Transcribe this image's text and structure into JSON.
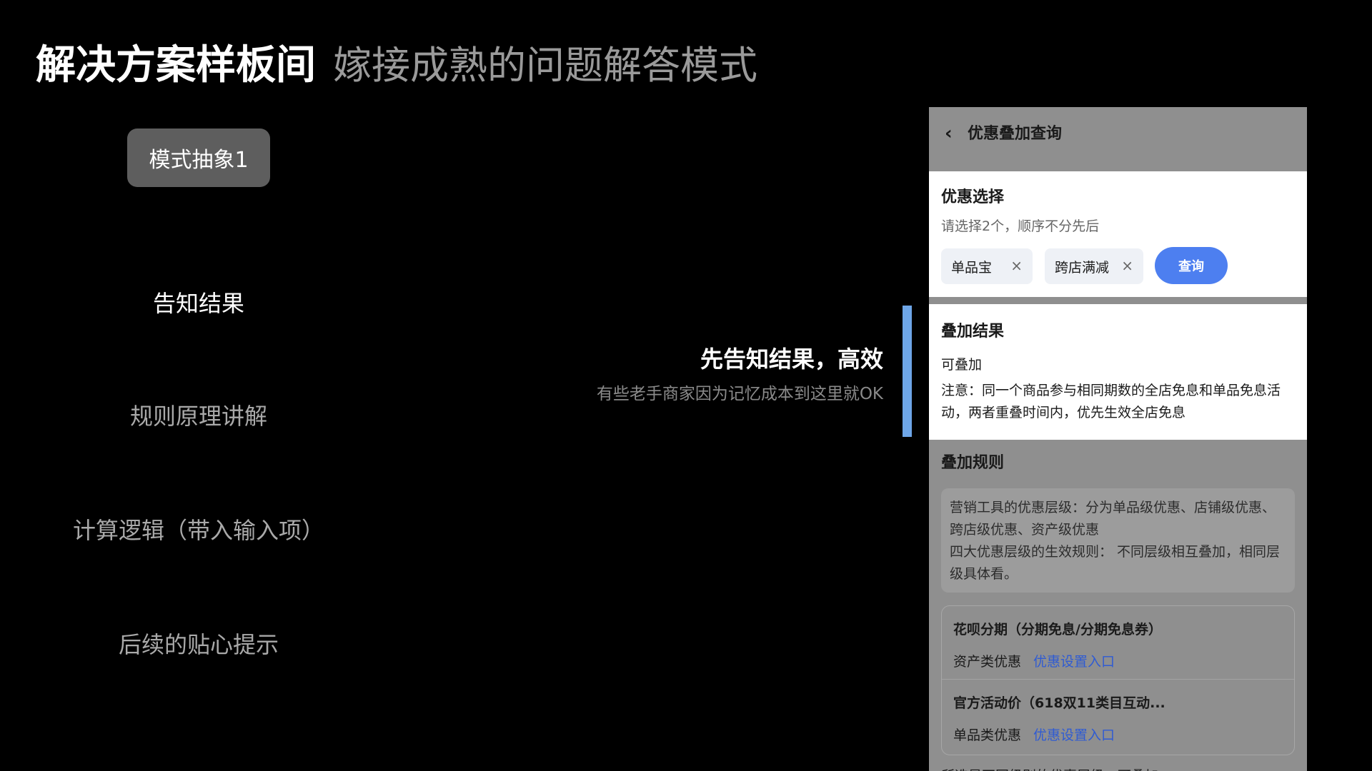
{
  "slide": {
    "title": "解决方案样板间",
    "subtitle": "嫁接成熟的问题解答模式",
    "mode_badge": "模式抽象1",
    "steps": [
      {
        "label": "告知结果",
        "active": true
      },
      {
        "label": "规则原理讲解",
        "active": false
      },
      {
        "label": "计算逻辑（带入输入项）",
        "active": false
      },
      {
        "label": "后续的贴心提示",
        "active": false
      }
    ],
    "callout": {
      "title": "先告知结果，高效",
      "description": "有些老手商家因为记忆成本到这里就OK"
    },
    "accent_color": "#6ea6e8"
  },
  "phone": {
    "header_title": "优惠叠加查询",
    "back_icon": "chevron-left-icon",
    "select_section": {
      "title": "优惠选择",
      "hint": "请选择2个，顺序不分先后",
      "chips": [
        {
          "label": "单品宝",
          "close_icon": "close-icon"
        },
        {
          "label": "跨店满减",
          "close_icon": "close-icon"
        }
      ],
      "query_button": "查询",
      "button_color": "#4d7ff0"
    },
    "result_section": {
      "title": "叠加结果",
      "status": "可叠加",
      "note": "注意：同一个商品参与相同期数的全店免息和单品免息活动，两者重叠时间内，优先生效全店免息"
    },
    "rules_section": {
      "title": "叠加规则",
      "lines": [
        "营销工具的优惠层级：分为单品级优惠、店铺级优惠、跨店级优惠、资产级优惠",
        "四大优惠层级的生效规则：  不同层级相互叠加，相同层级具体看。"
      ]
    },
    "promotions": [
      {
        "name": "花呗分期（分期免息/分期免息券）",
        "type": "资产类优惠",
        "link": "优惠设置入口"
      },
      {
        "name": "官方活动价（618双11类目互动...",
        "type": "单品类优惠",
        "link": "优惠设置入口"
      }
    ],
    "bottom_text": "所选是不同级别的优惠层级，可叠加",
    "link_color": "#2f5bd3"
  }
}
